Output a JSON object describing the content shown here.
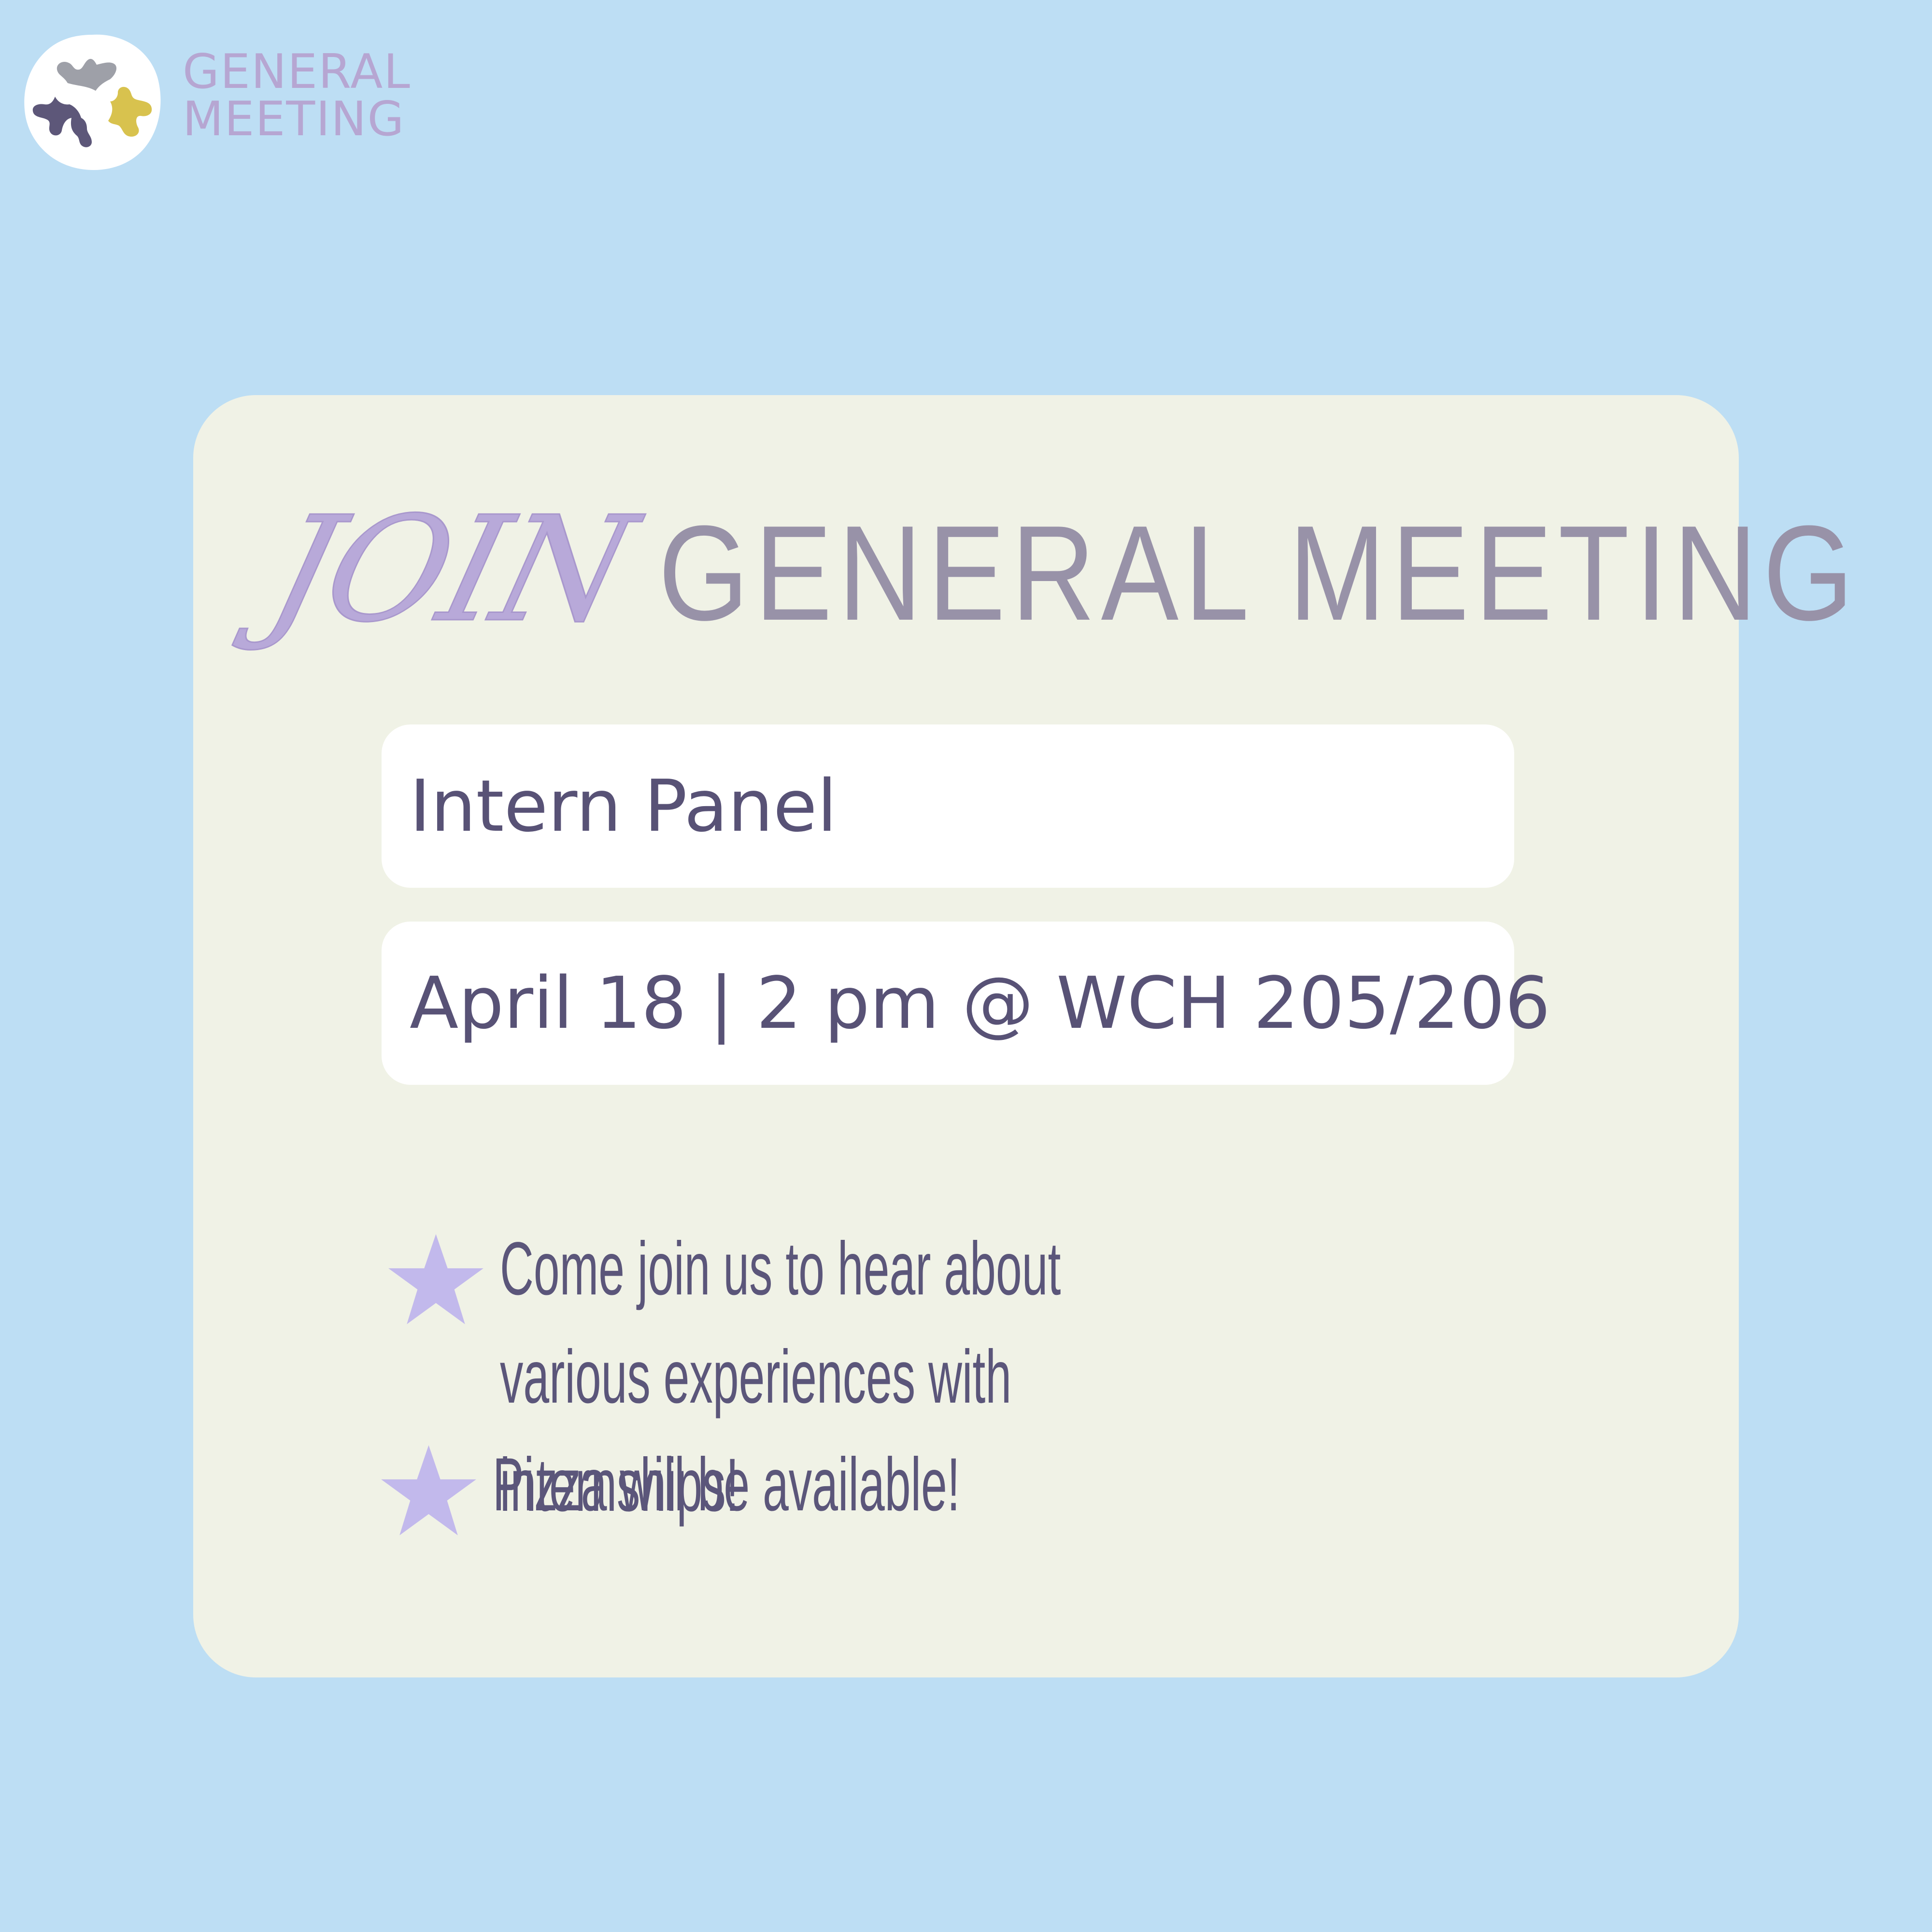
{
  "logo": {
    "line1": "GENERAL",
    "line2": "MEETING"
  },
  "headline": {
    "script_word": "JOIN",
    "title": "GENERAL MEETING"
  },
  "event": {
    "name": "Intern Panel",
    "when_where": "April 18 | 2 pm @ WCH 205/206"
  },
  "bullets": [
    {
      "icon": "star-icon",
      "text": "Come join us to hear about various experiences with internships!"
    },
    {
      "icon": "star-icon",
      "text": "Pizza will be available!"
    }
  ],
  "colors": {
    "background": "#bddef4",
    "card": "#f0f2e6",
    "accent_lavender": "#b6a6d2",
    "title_gray": "#9892a8",
    "text_purple": "#585276",
    "star": "#c2b9ec"
  }
}
